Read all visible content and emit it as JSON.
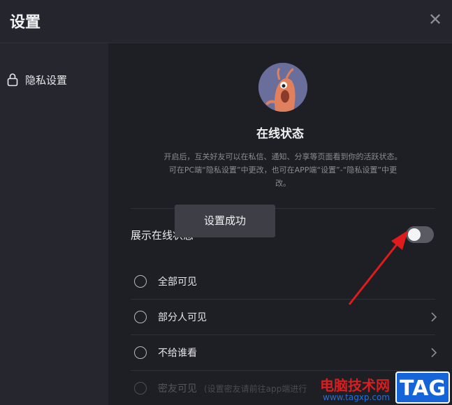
{
  "window": {
    "title": "设置",
    "close_glyph": "✕"
  },
  "sidebar": {
    "items": [
      {
        "label": "隐私设置",
        "icon": "lock-icon"
      }
    ]
  },
  "main": {
    "avatar_icon": "shrimp-mascot-avatar",
    "status_title": "在线状态",
    "description_lines": [
      "开启后，互关好友可以在私信、通知、分享等页面看到你的活跃状态。",
      "可在PC端“隐私设置”中更改，也可在APP端“设置”-“隐私设置”中更",
      "改。"
    ],
    "toast": "设置成功",
    "show_status_label": "展示在线状态",
    "toggle_on": false,
    "options": [
      {
        "label": "全部可见",
        "has_chevron": false,
        "disabled": false
      },
      {
        "label": "部分人可见",
        "has_chevron": true,
        "disabled": false
      },
      {
        "label": "不给谁看",
        "has_chevron": true,
        "disabled": false
      },
      {
        "label": "密友可见",
        "note": "(设置密友请前往app端进行",
        "has_chevron": false,
        "disabled": true
      }
    ]
  },
  "watermark": {
    "site": "电脑技术网",
    "url": "www.tagxp.com",
    "badge": "TAG"
  },
  "colors": {
    "background": "#1e1e25",
    "sidebar": "#26262e",
    "toggle_off": "#5a5a62",
    "arrow": "#e01b1b"
  }
}
